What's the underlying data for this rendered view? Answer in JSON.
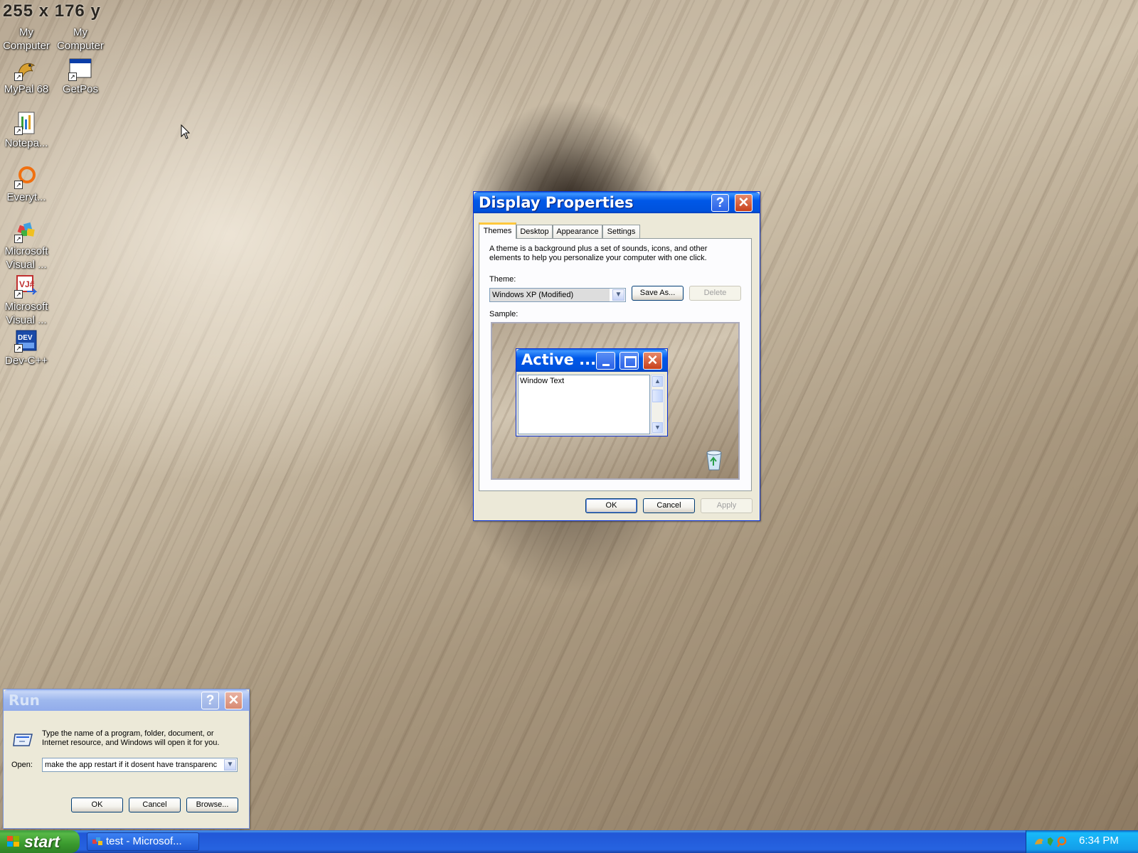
{
  "overlay": {
    "coords_text": "255 x 176 y"
  },
  "desktop": {
    "icons": [
      {
        "label": "My Computer"
      },
      {
        "label": "My Computer"
      },
      {
        "label": "MyPal 68"
      },
      {
        "label": "GetPos"
      },
      {
        "label": "Notepa..."
      },
      {
        "label": "Everyt..."
      },
      {
        "label": "Microsoft Visual ..."
      },
      {
        "label": "Microsoft Visual ..."
      },
      {
        "label": "Dev-C++"
      }
    ]
  },
  "display_properties": {
    "title": "Display Properties",
    "help_glyph": "?",
    "close_glyph": "✕",
    "tabs": [
      "Themes",
      "Desktop",
      "Appearance",
      "Settings"
    ],
    "active_tab": "Themes",
    "description": "A theme is a background plus a set of sounds, icons, and other elements to help you personalize your computer with one click.",
    "theme_label": "Theme:",
    "theme_value": "Windows XP (Modified)",
    "save_as_label": "Save As...",
    "delete_label": "Delete",
    "sample_label": "Sample:",
    "sample_window": {
      "title": "Active ...",
      "body_text": "Window Text"
    },
    "ok_label": "OK",
    "cancel_label": "Cancel",
    "apply_label": "Apply"
  },
  "run_dialog": {
    "title": "Run",
    "help_glyph": "?",
    "close_glyph": "✕",
    "description": "Type the name of a program, folder, document, or Internet resource, and Windows will open it for you.",
    "open_label": "Open:",
    "open_value": "make the app restart if it dosent have transparenc",
    "ok_label": "OK",
    "cancel_label": "Cancel",
    "browse_label": "Browse..."
  },
  "taskbar": {
    "start_label": "start",
    "task_item": "test - Microsof...",
    "clock": "6:34 PM"
  }
}
